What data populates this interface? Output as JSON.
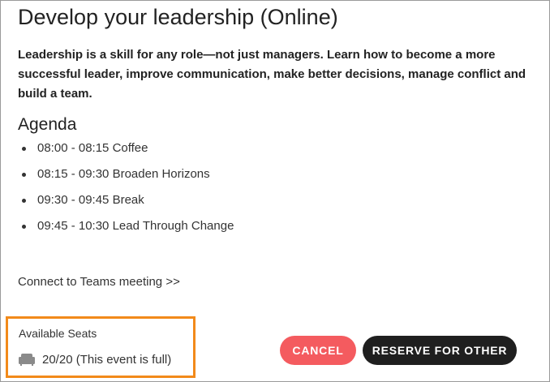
{
  "event": {
    "title": "Develop your leadership (Online)",
    "description": "Leadership is a skill for any role—not just managers. Learn how to become a more successful leader, improve communication, make better decisions, manage conflict and build a team."
  },
  "agenda": {
    "heading": "Agenda",
    "items": [
      {
        "text": "08:00 - 08:15 Coffee"
      },
      {
        "text": "08:15 - 09:30 Broaden Horizons"
      },
      {
        "text": "09:30 - 09:45 Break"
      },
      {
        "text": "09:45 - 10:30 Lead Through Change"
      }
    ]
  },
  "teams_link": {
    "label": "Connect to Teams meeting >>"
  },
  "seats": {
    "label": "Available Seats",
    "value": "20/20 (This event is full)",
    "icon": "armchair-icon",
    "highlight_color": "#f28a1a"
  },
  "actions": {
    "cancel_label": "CANCEL",
    "reserve_label": "RESERVE FOR OTHER",
    "cancel_color": "#f45b5f",
    "reserve_color": "#1f1f1f"
  }
}
